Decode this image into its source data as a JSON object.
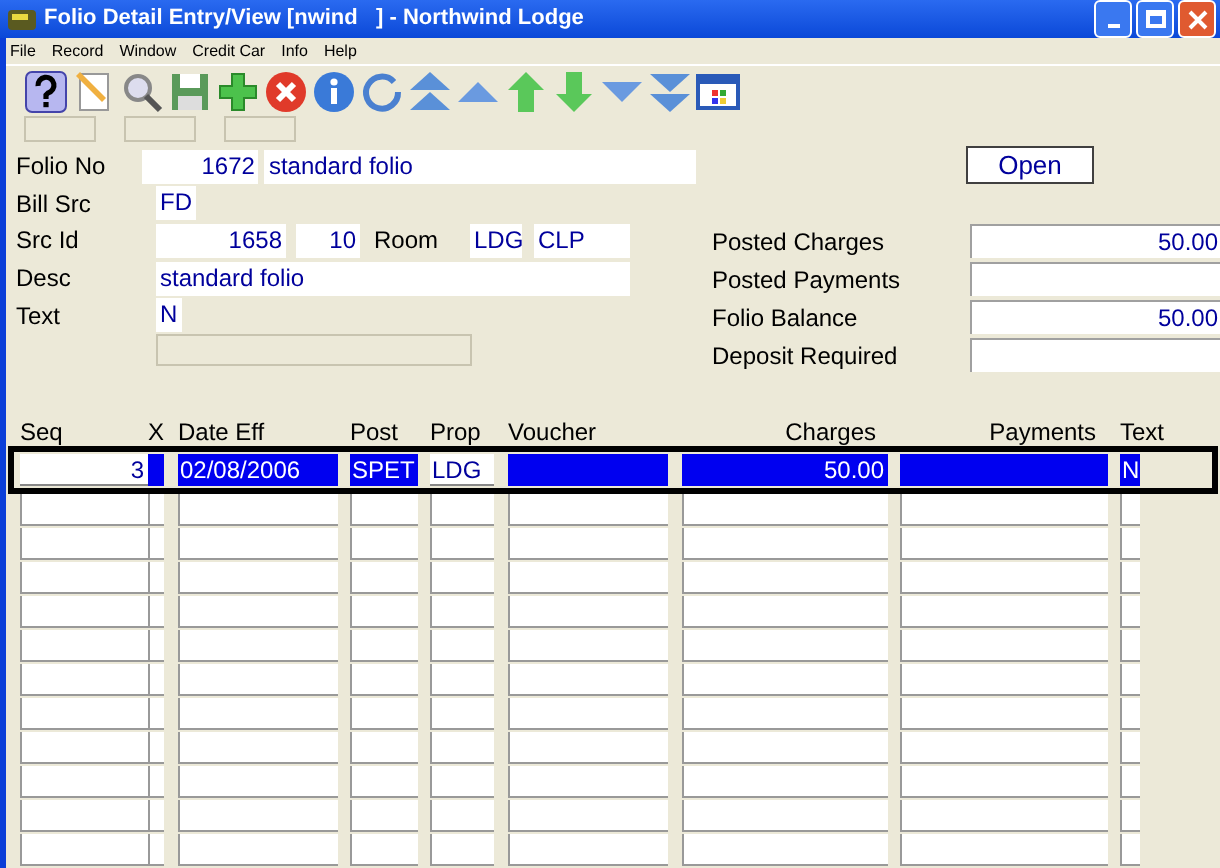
{
  "window": {
    "title": "Folio Detail Entry/View [nwind   ] - Northwind Lodge"
  },
  "menu": [
    "File",
    "Record",
    "Window",
    "Credit Car",
    "Info",
    "Help"
  ],
  "form": {
    "folio_no": {
      "label": "Folio No",
      "number": "1672",
      "name": "standard folio"
    },
    "bill_src": {
      "label": "Bill Src",
      "value": "FD"
    },
    "src_id": {
      "label": "Src Id",
      "number": "1658",
      "sub": "10",
      "room_label": "Room",
      "room_code": "LDG",
      "room_type": "CLP"
    },
    "desc": {
      "label": "Desc",
      "value": "standard folio"
    },
    "text": {
      "label": "Text",
      "value": "N"
    }
  },
  "open_button": "Open",
  "summary": [
    {
      "label": "Posted Charges",
      "value": "50.00"
    },
    {
      "label": "Posted Payments"
    },
    {
      "label": "Folio Balance",
      "value": "50.00"
    },
    {
      "label": "Deposit Required"
    }
  ],
  "table": {
    "columns": [
      "Seq",
      "X",
      "Date Eff",
      "Post",
      "Prop",
      "Voucher",
      "Charges",
      "Payments",
      "Text"
    ],
    "rows": [
      {
        "selected": true,
        "cells": [
          {
            "text": "3",
            "highlighted": false
          },
          {
            "highlighted": true
          },
          {
            "text": "02/08/2006",
            "highlighted": true
          },
          {
            "text": "SPET",
            "highlighted": true
          },
          {
            "text": "LDG",
            "highlighted": false
          },
          {
            "highlighted": true
          },
          {
            "text": "50.00",
            "highlighted": true
          },
          {
            "highlighted": true
          },
          {
            "text": "N",
            "highlighted": true
          }
        ]
      }
    ]
  }
}
